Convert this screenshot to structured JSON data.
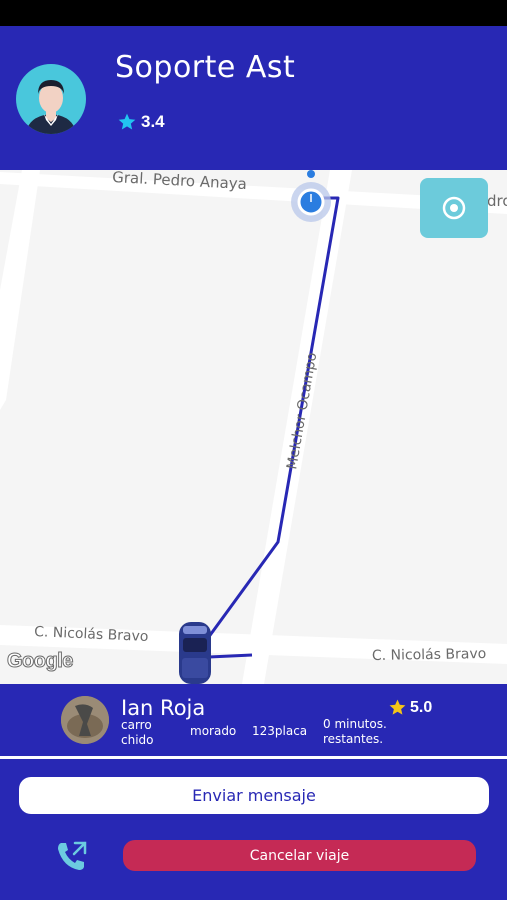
{
  "header": {
    "name": "Soporte Ast",
    "rating": "3.4"
  },
  "map": {
    "streets": {
      "top": "Gral. Pedro Anaya",
      "top_right": "dro",
      "vertical": "Melchor Ocampo",
      "bottom_left": "C. Nicolás Bravo",
      "bottom_right": "C. Nicolás Bravo"
    },
    "attribution": "Google",
    "route_color": "#2828b4"
  },
  "driver": {
    "name": "Ian Roja",
    "car_model": "carro chido",
    "car_color": "morado",
    "plate": "123placa",
    "eta": "0 minutos. restantes.",
    "rating": "5.0"
  },
  "actions": {
    "message_label": "Enviar mensaje",
    "cancel_label": "Cancelar viaje"
  },
  "colors": {
    "primary": "#2828b4",
    "accent": "#49c7dc",
    "cancel": "#c52a55",
    "star_header": "#22c4f0",
    "star_driver": "#f5c518"
  },
  "icons": {
    "locate": "locate-icon",
    "phone": "phone-icon",
    "star": "star-icon"
  }
}
